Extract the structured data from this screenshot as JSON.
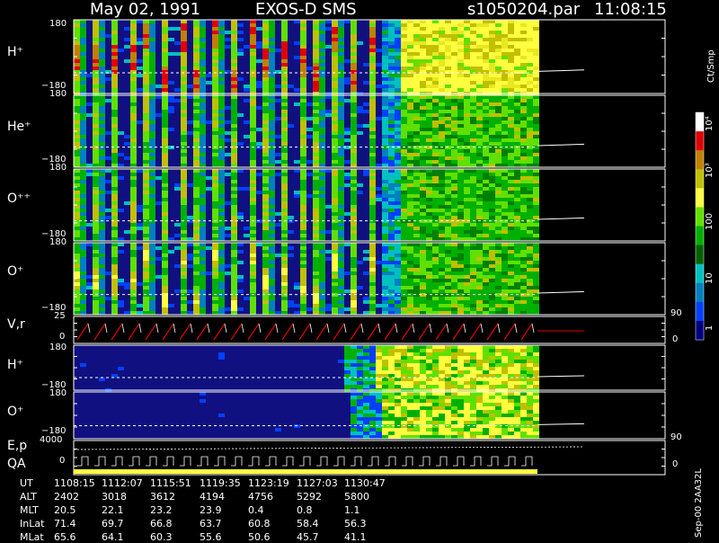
{
  "header": {
    "date": "May 02, 1991",
    "instrument": "EXOS-D SMS",
    "file": "s1050204.par",
    "time": "11:08:15"
  },
  "colorbar": {
    "unit": "Ct/Smp",
    "ticks": [
      "10⁴",
      "10³",
      "100",
      "10",
      "1"
    ],
    "stops": [
      "#ffffff",
      "#e00000",
      "#c08000",
      "#c0c000",
      "#ffff40",
      "#60e000",
      "#00b000",
      "#006000",
      "#00c0c0",
      "#0080c0",
      "#0040ff",
      "#000080"
    ]
  },
  "panels": [
    {
      "label": "H⁺",
      "ymax": "180",
      "ymin": "−180"
    },
    {
      "label": "He⁺",
      "ymax": "180",
      "ymin": "−180"
    },
    {
      "label": "O⁺⁺",
      "ymax": "180",
      "ymin": "−180"
    },
    {
      "label": "O⁺",
      "ymax": "180",
      "ymin": "−180"
    },
    {
      "label": "V,r",
      "ymax": "25",
      "ymin": "0",
      "rmax": "90",
      "rmin": "0"
    },
    {
      "label": "H⁺",
      "ymax": "180",
      "ymin": "−180"
    },
    {
      "label": "O⁺",
      "ymax": "180",
      "ymin": "−180"
    },
    {
      "label": "E,p",
      "label2": "QA",
      "ymax": "4000",
      "ymin": "0",
      "rmax": "90",
      "rmin": "0"
    }
  ],
  "footer": {
    "version": "Sep-00 2AA32L",
    "rows": [
      {
        "name": "UT",
        "values": [
          "1108:15",
          "1112:07",
          "1115:51",
          "1119:35",
          "1123:19",
          "1127:03",
          "1130:47"
        ]
      },
      {
        "name": "ALT",
        "values": [
          "2402",
          "3018",
          "3612",
          "4194",
          "4756",
          "5292",
          "5800"
        ]
      },
      {
        "name": "MLT",
        "values": [
          "20.5",
          "22.1",
          "23.2",
          "23.9",
          "0.4",
          "0.8",
          "1.1"
        ]
      },
      {
        "name": "InLat",
        "values": [
          "71.4",
          "69.7",
          "66.8",
          "63.7",
          "60.8",
          "58.4",
          "56.3"
        ]
      },
      {
        "name": "MLat",
        "values": [
          "65.6",
          "64.1",
          "60.3",
          "55.6",
          "50.6",
          "45.7",
          "41.1"
        ]
      }
    ]
  },
  "chart_data": {
    "type": "heatmap",
    "title": "May 02, 1991  EXOS-D SMS",
    "xlabel": "UT",
    "x_ticks": [
      "1108:15",
      "1112:07",
      "1115:51",
      "1119:35",
      "1123:19",
      "1127:03",
      "1130:47"
    ],
    "series": [
      {
        "name": "H⁺",
        "ylim": [
          -180,
          180
        ]
      },
      {
        "name": "He⁺",
        "ylim": [
          -180,
          180
        ]
      },
      {
        "name": "O⁺⁺",
        "ylim": [
          -180,
          180
        ]
      },
      {
        "name": "O⁺",
        "ylim": [
          -180,
          180
        ]
      },
      {
        "name": "V,r",
        "ylim": [
          0,
          25
        ]
      },
      {
        "name": "H⁺",
        "ylim": [
          -180,
          180
        ]
      },
      {
        "name": "O⁺",
        "ylim": [
          -180,
          180
        ]
      },
      {
        "name": "E,p",
        "ylim": [
          0,
          4000
        ]
      }
    ],
    "colorscale": "log",
    "clim": [
      1,
      10000
    ],
    "zlabel": "Ct/Smp"
  }
}
